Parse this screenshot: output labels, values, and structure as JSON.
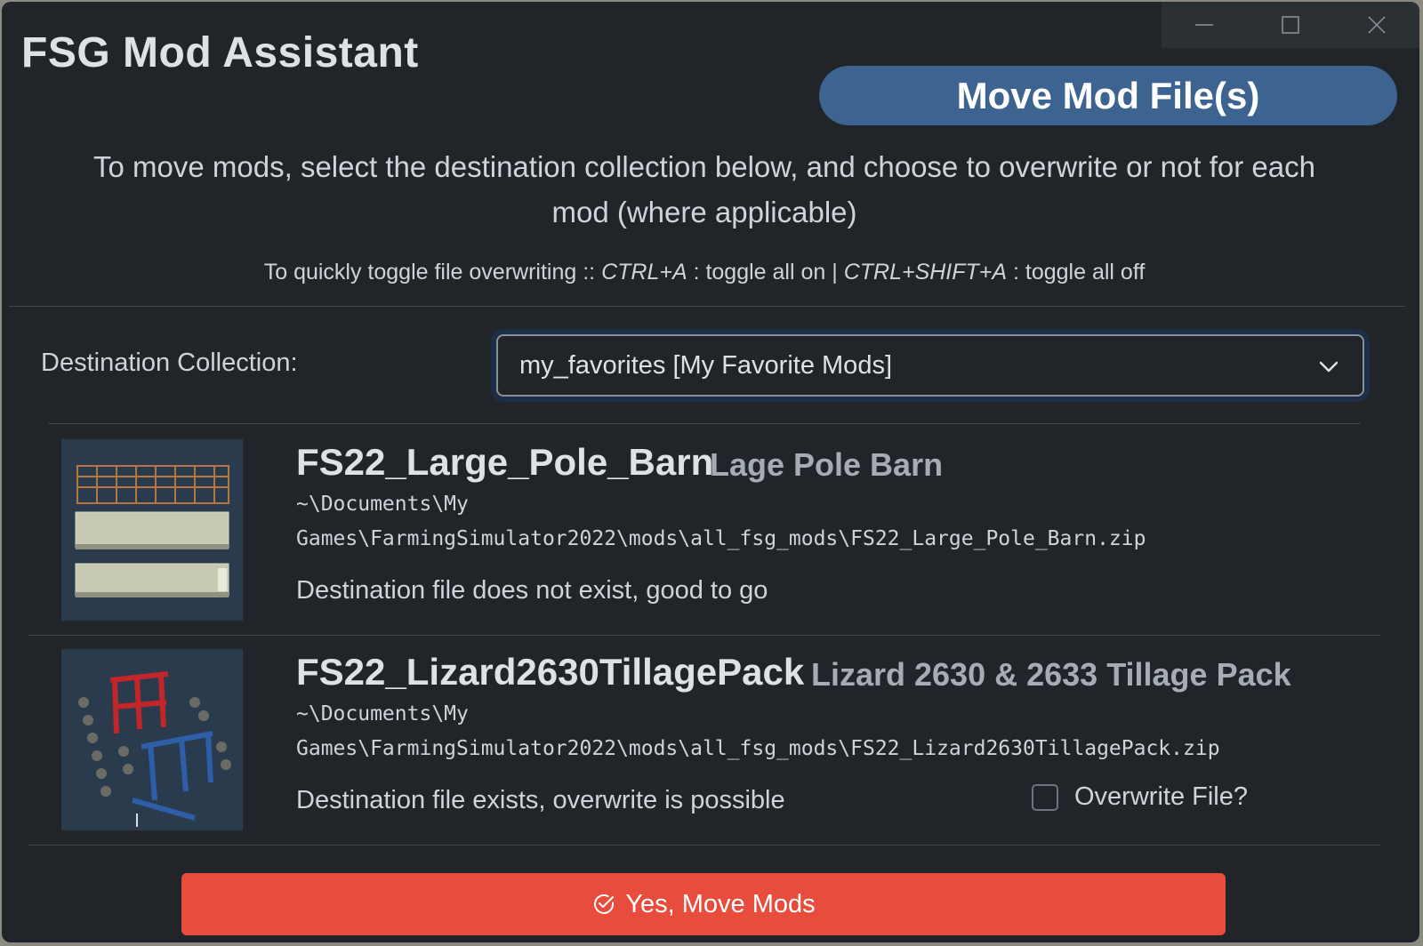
{
  "app": {
    "title": "FSG Mod Assistant"
  },
  "window_controls": {
    "minimize_icon": "minimize-icon",
    "maximize_icon": "maximize-icon",
    "close_icon": "close-icon"
  },
  "header": {
    "page_title": "Move Mod File(s)",
    "accent_color": "#3d6390"
  },
  "instructions": {
    "main": "To move mods, select the destination collection below, and choose to overwrite or not for each mod (where applicable)",
    "hint_prefix": "To quickly toggle file overwriting :: ",
    "hint_key_on": "CTRL+A",
    "hint_middle": " : toggle all on | ",
    "hint_key_off": "CTRL+SHIFT+A",
    "hint_suffix": " : toggle all off"
  },
  "destination": {
    "label": "Destination Collection:",
    "selected": "my_favorites [My Favorite Mods]"
  },
  "mods": [
    {
      "name": "FS22_Large_Pole_Barn",
      "title": "Lage Pole Barn",
      "path_line1": "~\\Documents\\My",
      "path_line2": "Games\\FarmingSimulator2022\\mods\\all_fsg_mods\\FS22_Large_Pole_Barn.zip",
      "status": "Destination file does not exist, good to go",
      "thumbnail_icon": "pole-barn-thumbnail"
    },
    {
      "name": "FS22_Lizard2630TillagePack",
      "title": "Lizard 2630 & 2633 Tillage Pack",
      "path_line1": "~\\Documents\\My",
      "path_line2": "Games\\FarmingSimulator2022\\mods\\all_fsg_mods\\FS22_Lizard2630TillagePack.zip",
      "status": "Destination file exists, overwrite is possible",
      "overwrite_label": "Overwrite File?",
      "overwrite_checked": false,
      "thumbnail_icon": "tillage-pack-thumbnail"
    }
  ],
  "actions": {
    "confirm_label": "Yes, Move Mods",
    "confirm_icon": "check-circle-icon",
    "confirm_color": "#e74c3c"
  }
}
